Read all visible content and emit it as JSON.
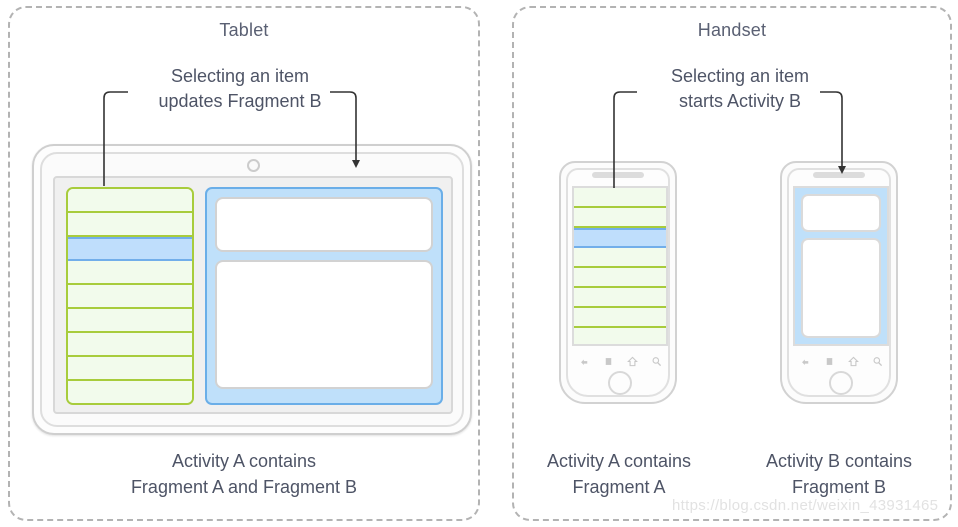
{
  "panels": [
    {
      "id": "tablet",
      "title": "Tablet",
      "callout": "Selecting an item\nupdates Fragment B",
      "caption": "Activity A contains\nFragment A and Fragment B"
    },
    {
      "id": "handset",
      "title": "Handset",
      "callout": "Selecting an item\nstarts Activity B",
      "captions": [
        "Activity A contains\nFragment A",
        "Activity B contains\nFragment B"
      ]
    }
  ],
  "tablet_device": {
    "camera_icon": "camera-dot-icon",
    "fragment_a": {
      "name": "Fragment A",
      "row_count": 9,
      "selected_row_index": 2
    },
    "fragment_b": {
      "name": "Fragment B",
      "card_count": 2
    }
  },
  "phones": [
    {
      "id": "phone-a",
      "contains": "Fragment A",
      "fragment_a": {
        "row_count": 8,
        "selected_row_index": 2
      },
      "nav_icons": [
        "back-icon",
        "menu-icon",
        "home-icon",
        "search-icon"
      ],
      "trackball_icon": "trackball-icon"
    },
    {
      "id": "phone-b",
      "contains": "Fragment B",
      "fragment_b": {
        "card_count": 2
      },
      "nav_icons": [
        "back-icon",
        "menu-icon",
        "home-icon",
        "search-icon"
      ],
      "trackball_icon": "trackball-icon"
    }
  ],
  "colors": {
    "panel_border": "#b3b3b3",
    "text": "#4e5466",
    "title": "#5a6073",
    "list_green_border": "#a8cc3c",
    "list_green_fill": "#f2fbec",
    "selected_blue_fill": "#bfdefc",
    "selected_blue_border": "#72aeea",
    "fragment_b_fill": "#bfe0fa",
    "fragment_b_border": "#6aaee8",
    "leader_line": "#333333"
  },
  "watermark": "https://blog.csdn.net/weixin_43931465"
}
